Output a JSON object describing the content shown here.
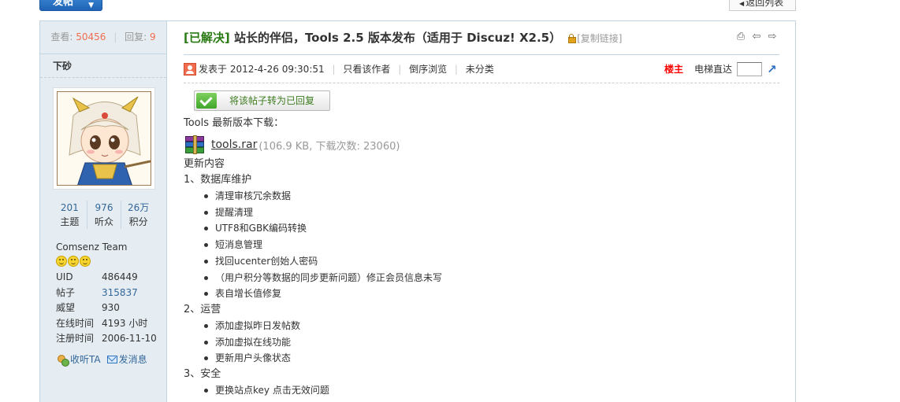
{
  "top": {
    "post_button": "发帖",
    "back_button": "返回列表"
  },
  "stats": {
    "views_label": "查看:",
    "views": "50456",
    "replies_label": "回复:",
    "replies": "9"
  },
  "author": {
    "name": "下砂",
    "counts": [
      {
        "value": "201",
        "label": "主题"
      },
      {
        "value": "976",
        "label": "听众"
      },
      {
        "value": "26万",
        "label": "积分"
      }
    ],
    "group": "Comsenz Team",
    "info": [
      {
        "key": "UID",
        "value": "486449"
      },
      {
        "key": "帖子",
        "value": "315837"
      },
      {
        "key": "威望",
        "value": "930"
      },
      {
        "key": "在线时间",
        "value": "4193 小时"
      },
      {
        "key": "注册时间",
        "value": "2006-11-10"
      }
    ],
    "follow": "收听TA",
    "message": "发消息"
  },
  "thread": {
    "status": "[已解决]",
    "title": " 站长的伴侣，Tools 2.5 版本发布（适用于 Discuz! X2.5）",
    "copy_link": "[复制链接]"
  },
  "meta": {
    "posted": "发表于 2012-4-26 09:30:51",
    "only_author": "只看该作者",
    "reverse": "倒序浏览",
    "category": "未分类",
    "floor": "楼主",
    "jump": "电梯直达"
  },
  "reply_button": "将该帖子转为已回复",
  "content": {
    "download_heading": "Tools 最新版本下载：",
    "file_name": "tools.rar",
    "file_meta": "(106.9 KB, 下载次数: 23060)",
    "update_heading": "更新内容",
    "sections": [
      {
        "title": "1、数据库维护",
        "items": [
          "清理审核冗余数据",
          "提醒清理",
          "UTF8和GBK编码转换",
          "短消息管理",
          "找回ucenter创始人密码",
          "（用户积分等数据的同步更新问题）修正会员信息未写",
          "表自增长值修复"
        ]
      },
      {
        "title": "2、运营",
        "items": [
          "添加虚拟昨日发帖数",
          "添加虚拟在线功能",
          "更新用户头像状态"
        ]
      },
      {
        "title": "3、安全",
        "items": [
          "更换站点key 点击无效问题"
        ]
      }
    ]
  },
  "icons": {
    "print": "printer-icon",
    "prev": "previous-thread-icon",
    "next": "next-thread-icon"
  }
}
